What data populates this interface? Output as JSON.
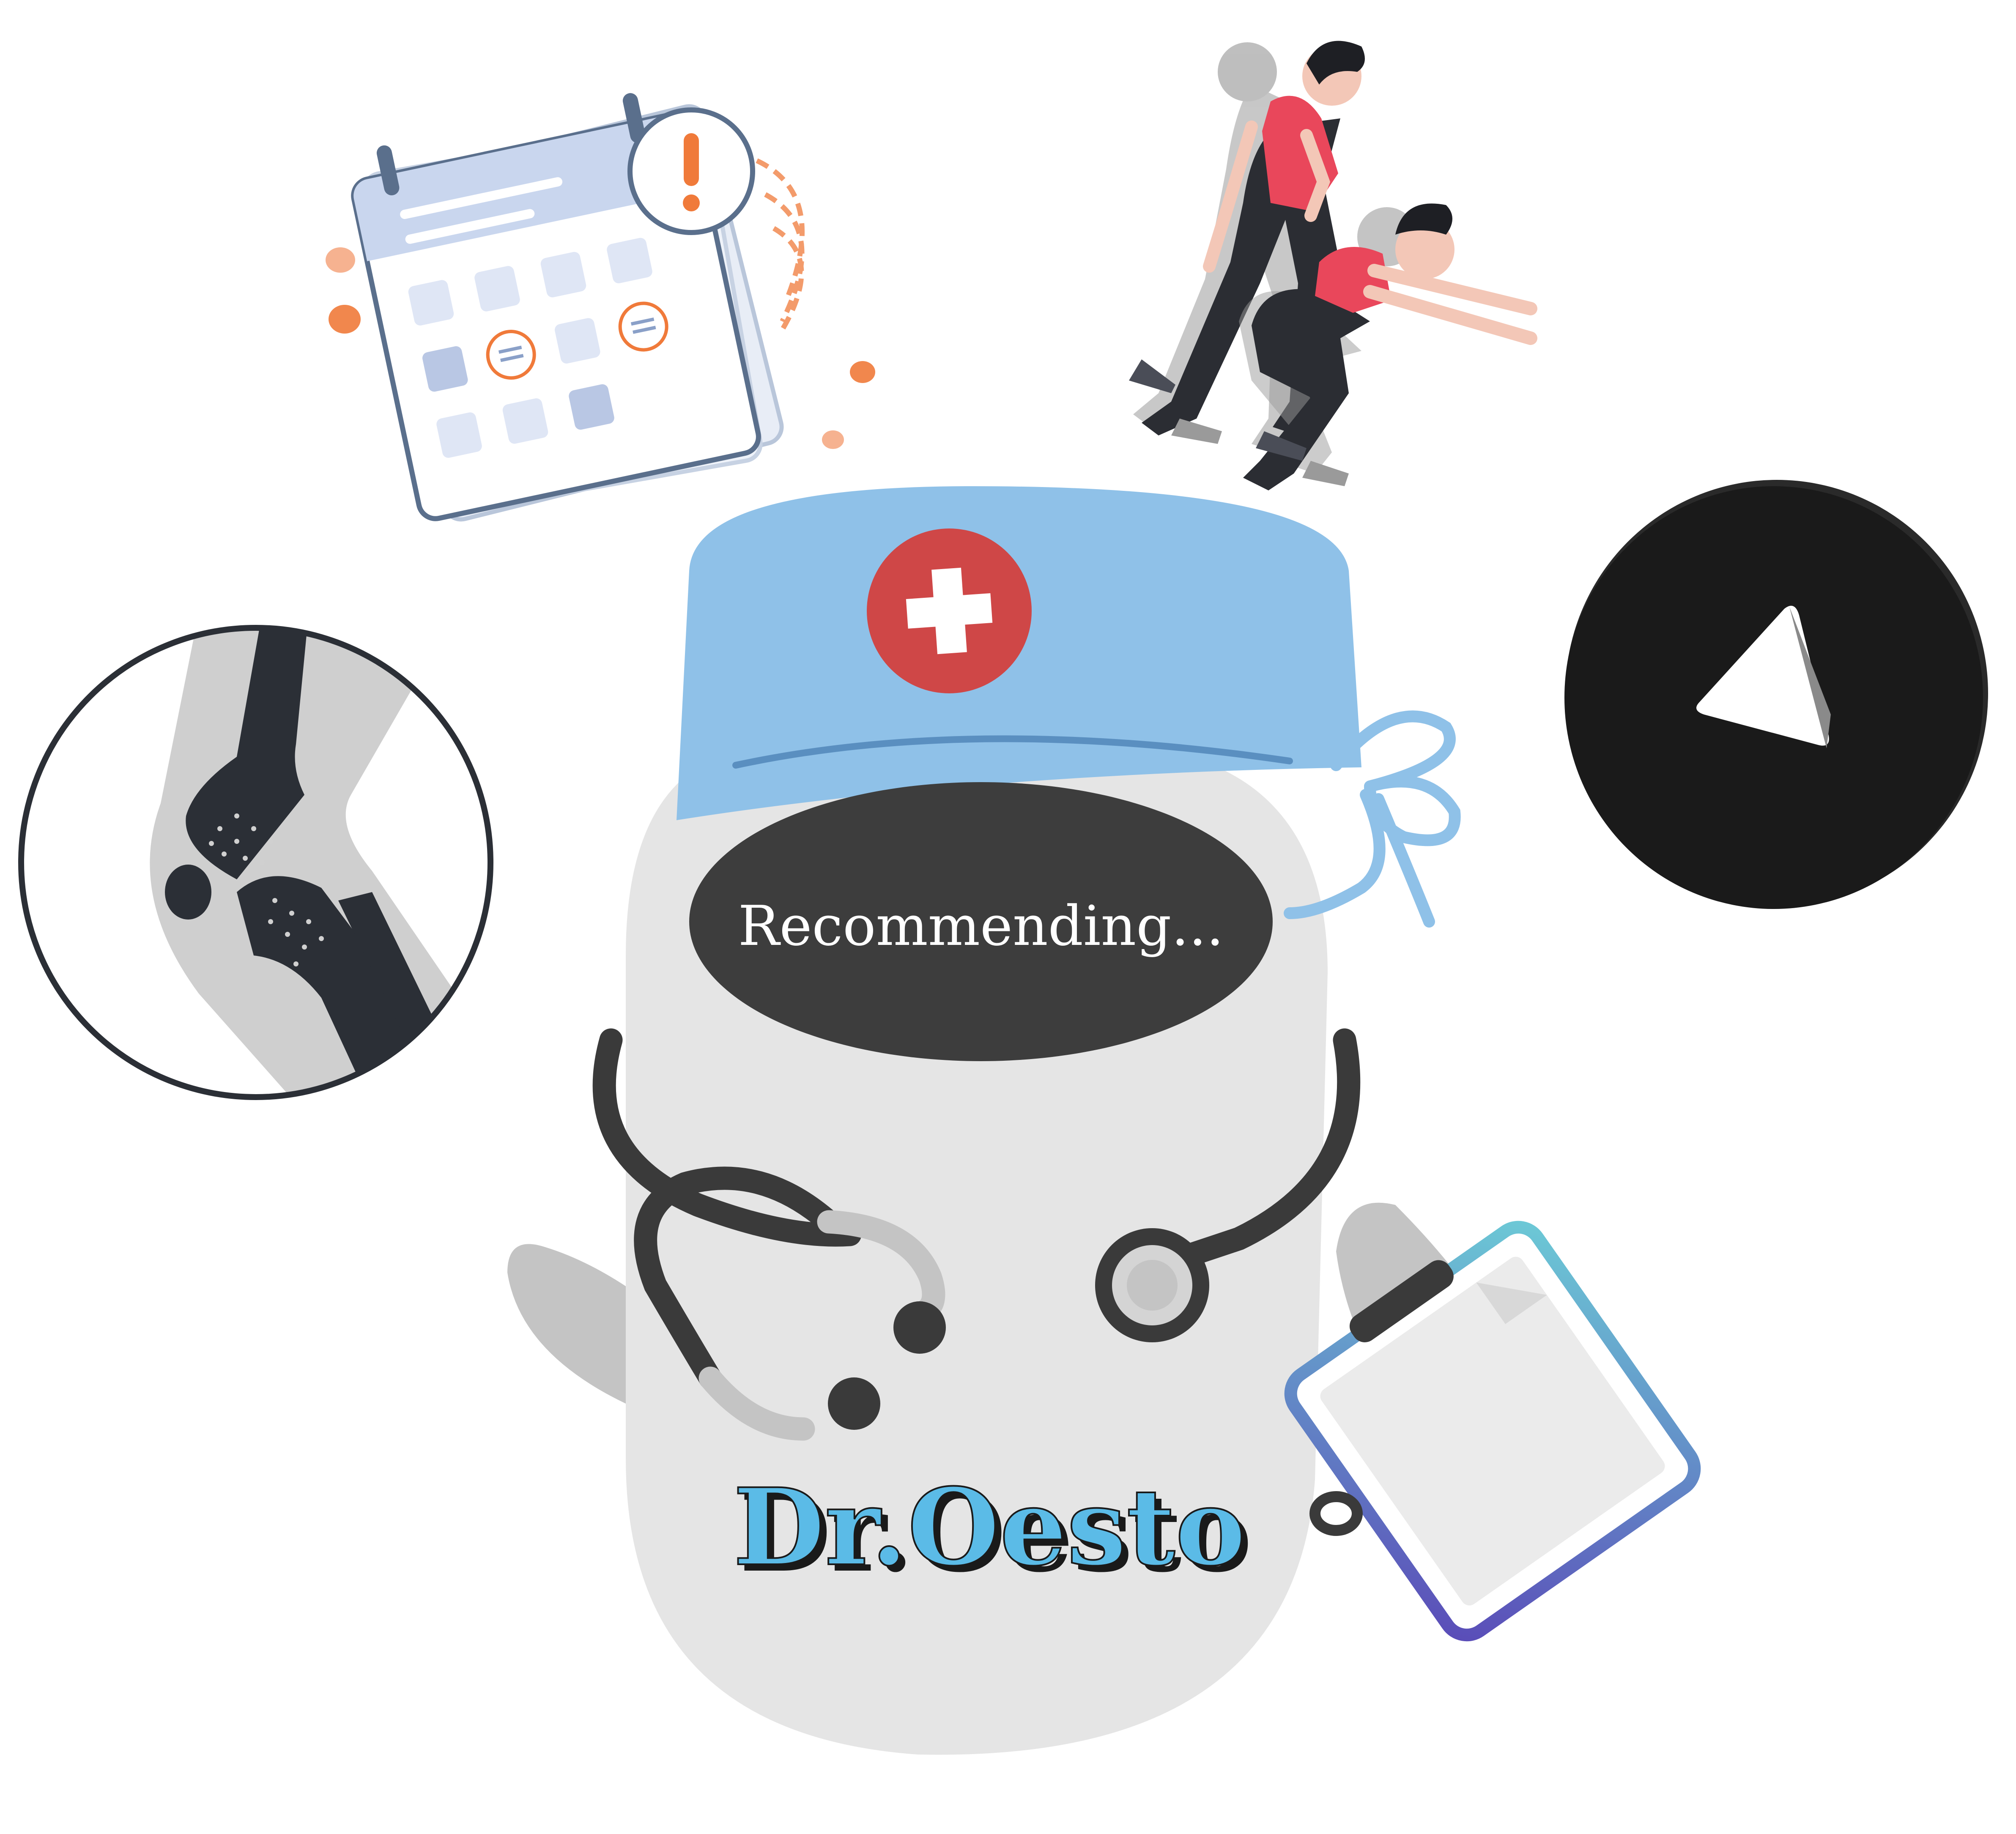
{
  "screen": {
    "status_text": "Recommending...",
    "brand_name": "Dr.Oesto"
  },
  "icons": [
    {
      "name": "calendar-alert-icon"
    },
    {
      "name": "exercise-squat-icon"
    },
    {
      "name": "knee-joint-icon"
    },
    {
      "name": "play-icon"
    },
    {
      "name": "doctor-robot-mascot"
    },
    {
      "name": "clipboard-icon"
    },
    {
      "name": "stethoscope-icon"
    },
    {
      "name": "medical-cross-icon"
    }
  ],
  "colors": {
    "background": "#ffffff",
    "robot_body": "#e5e5e5",
    "robot_arm": "#c4c4c4",
    "cap": "#8fc1e8",
    "cap_band": "#5a8fc0",
    "cross_red": "#cf4747",
    "visor": "#3d3d3d",
    "visor_text": "#ffffff",
    "brand_text": "#5bbbe7",
    "brand_shadow": "#1a1a1a",
    "stethoscope": "#3a3a3a",
    "play_circle": "#1a1a1a",
    "knee_ring": "#2b2f36",
    "calendar_blue": "#c9d6ee",
    "calendar_stroke": "#5a6f8c",
    "alert_orange": "#f07a3a",
    "clipboard_top": "#6cc9d6",
    "clipboard_bottom": "#5a4cb8",
    "athlete_top": "#e9475b"
  }
}
